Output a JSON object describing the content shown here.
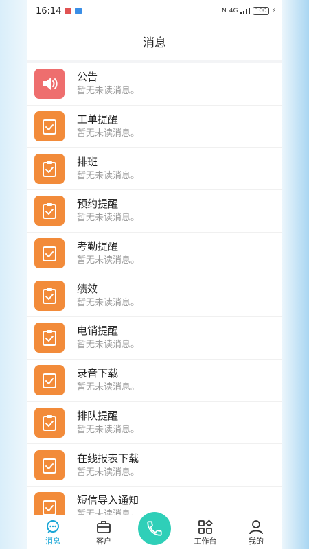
{
  "status_bar": {
    "time": "16:14",
    "network": "4G",
    "battery": "100"
  },
  "header": {
    "title": "消息"
  },
  "messages": [
    {
      "title": "公告",
      "subtitle": "暂无未读消息。",
      "icon": "speaker-icon",
      "color": "#ee6e6e"
    },
    {
      "title": "工单提醒",
      "subtitle": "暂无未读消息。",
      "icon": "clipboard-check-icon",
      "color": "#f28b3a"
    },
    {
      "title": "排班",
      "subtitle": "暂无未读消息。",
      "icon": "clipboard-check-icon",
      "color": "#f28b3a"
    },
    {
      "title": "预约提醒",
      "subtitle": "暂无未读消息。",
      "icon": "clipboard-check-icon",
      "color": "#f28b3a"
    },
    {
      "title": "考勤提醒",
      "subtitle": "暂无未读消息。",
      "icon": "clipboard-check-icon",
      "color": "#f28b3a"
    },
    {
      "title": "绩效",
      "subtitle": "暂无未读消息。",
      "icon": "clipboard-check-icon",
      "color": "#f28b3a"
    },
    {
      "title": "电销提醒",
      "subtitle": "暂无未读消息。",
      "icon": "clipboard-check-icon",
      "color": "#f28b3a"
    },
    {
      "title": "录音下载",
      "subtitle": "暂无未读消息。",
      "icon": "clipboard-check-icon",
      "color": "#f28b3a"
    },
    {
      "title": "排队提醒",
      "subtitle": "暂无未读消息。",
      "icon": "clipboard-check-icon",
      "color": "#f28b3a"
    },
    {
      "title": "在线报表下载",
      "subtitle": "暂无未读消息。",
      "icon": "clipboard-check-icon",
      "color": "#f28b3a"
    },
    {
      "title": "短信导入通知",
      "subtitle": "暂无未读消息。",
      "icon": "clipboard-check-icon",
      "color": "#f28b3a"
    }
  ],
  "tabbar": {
    "messages": "消息",
    "customers": "客户",
    "workbench": "工作台",
    "mine": "我的",
    "active_color": "#1aa6d6",
    "call_color": "#2fcfb8"
  }
}
